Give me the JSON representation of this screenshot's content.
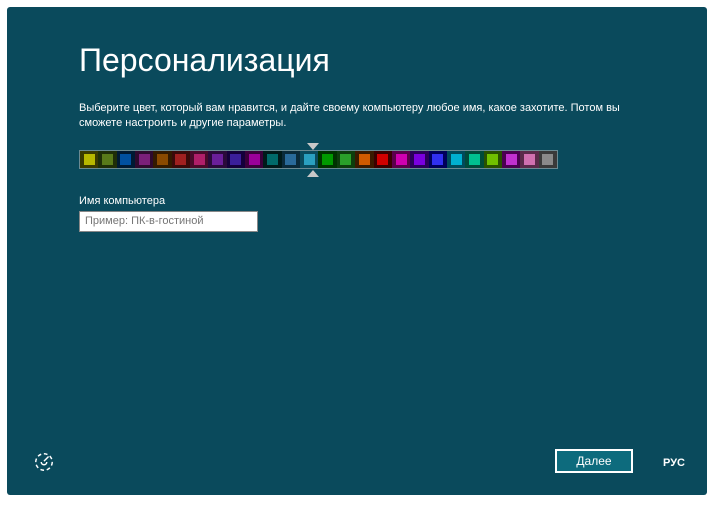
{
  "title": "Персонализация",
  "description": "Выберите цвет, который вам нравится, и дайте своему компьютеру любое имя, какое захотите. Потом вы сможете настроить и другие параметры.",
  "pc_name_label": "Имя компьютера",
  "pc_name_placeholder": "Пример: ПК-в-гостиной",
  "pc_name_value": "",
  "next_label": "Далее",
  "lang_label": "РУС",
  "selected_color_index": 12,
  "colors": [
    {
      "bg": "#3a3a00",
      "fg": "#b8b800"
    },
    {
      "bg": "#1f2e08",
      "fg": "#597a1a"
    },
    {
      "bg": "#001a33",
      "fg": "#0050a0"
    },
    {
      "bg": "#2e0a2e",
      "fg": "#7a1f7a"
    },
    {
      "bg": "#331a00",
      "fg": "#8a4a00"
    },
    {
      "bg": "#3a0a0a",
      "fg": "#a02020"
    },
    {
      "bg": "#4a0a2a",
      "fg": "#b01f6a"
    },
    {
      "bg": "#2a0a3a",
      "fg": "#6a1f9a"
    },
    {
      "bg": "#14003a",
      "fg": "#3a1f9a"
    },
    {
      "bg": "#3a003a",
      "fg": "#9a009a"
    },
    {
      "bg": "#001a1a",
      "fg": "#006a6a"
    },
    {
      "bg": "#0a2a3a",
      "fg": "#2a6a9a"
    },
    {
      "bg": "#0a4a5c",
      "fg": "#2aa0c0"
    },
    {
      "bg": "#003300",
      "fg": "#009900"
    },
    {
      "bg": "#0d3d0d",
      "fg": "#2aa02a"
    },
    {
      "bg": "#3a1a00",
      "fg": "#d05a00"
    },
    {
      "bg": "#3a0000",
      "fg": "#d00000"
    },
    {
      "bg": "#5a004a",
      "fg": "#d000b0"
    },
    {
      "bg": "#2a005a",
      "fg": "#7a00e0"
    },
    {
      "bg": "#00005a",
      "fg": "#3030f0"
    },
    {
      "bg": "#004a5a",
      "fg": "#00b0d0"
    },
    {
      "bg": "#004a3a",
      "fg": "#00c090"
    },
    {
      "bg": "#285000",
      "fg": "#70c000"
    },
    {
      "bg": "#4a0050",
      "fg": "#c030d0"
    },
    {
      "bg": "#5a2a4a",
      "fg": "#d070b0"
    },
    {
      "bg": "#3a3a3a",
      "fg": "#8a8a8a"
    }
  ]
}
